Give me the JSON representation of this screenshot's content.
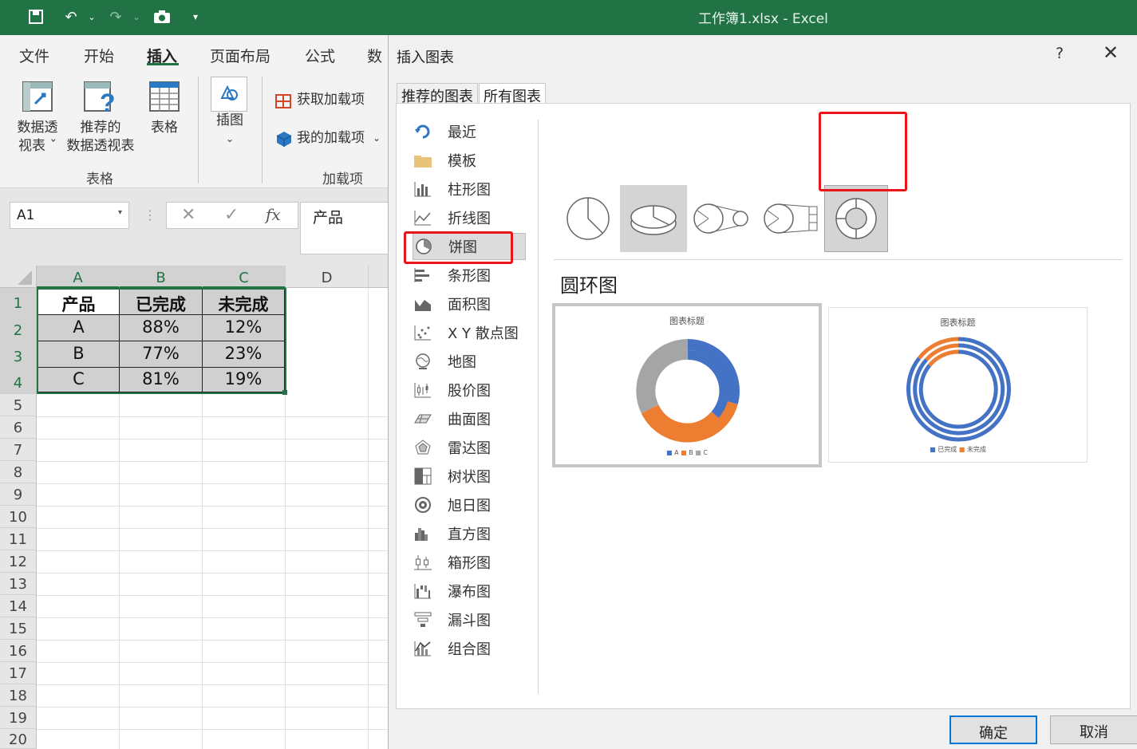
{
  "titlebar": {
    "title": "工作簿1.xlsx  -  Excel"
  },
  "ribbon": {
    "tabs": [
      "文件",
      "开始",
      "插入",
      "页面布局",
      "公式",
      "数"
    ],
    "active_tab": "插入",
    "buttons": {
      "pivot_table": [
        "数据透",
        "视表 ˇ"
      ],
      "recommended_pivot": [
        "推荐的",
        "数据透视表"
      ],
      "table": "表格",
      "illustrations": "插图",
      "get_addins": "获取加载项",
      "my_addins": "我的加载项"
    },
    "groups": {
      "tables": "表格",
      "addins": "加载项"
    }
  },
  "formula_bar": {
    "name_box": "A1",
    "value": "产品"
  },
  "sheet": {
    "columns": [
      "A",
      "B",
      "C",
      "D"
    ],
    "rows": [
      "1",
      "2",
      "3",
      "4",
      "5",
      "6",
      "7",
      "8",
      "9",
      "10",
      "11",
      "12",
      "13",
      "14",
      "15",
      "16",
      "17",
      "18",
      "19",
      "20"
    ],
    "table": [
      [
        "产品",
        "已完成",
        "未完成"
      ],
      [
        "A",
        "88%",
        "12%"
      ],
      [
        "B",
        "77%",
        "23%"
      ],
      [
        "C",
        "81%",
        "19%"
      ]
    ]
  },
  "dialog": {
    "title": "插入图表",
    "help": "?",
    "tabs": [
      "推荐的图表",
      "所有图表"
    ],
    "active_tab": "所有图表",
    "categories": [
      "最近",
      "模板",
      "柱形图",
      "折线图",
      "饼图",
      "条形图",
      "面积图",
      "X Y 散点图",
      "地图",
      "股价图",
      "曲面图",
      "雷达图",
      "树状图",
      "旭日图",
      "直方图",
      "箱形图",
      "瀑布图",
      "漏斗图",
      "组合图"
    ],
    "selected_category": "饼图",
    "subtypes": [
      "pie",
      "3d-pie",
      "pie-of-pie",
      "bar-of-pie",
      "doughnut"
    ],
    "selected_subtype": "doughnut",
    "preview_heading": "圆环图",
    "previews": [
      {
        "title": "图表标题",
        "legend": [
          "A",
          "B",
          "C"
        ]
      },
      {
        "title": "图表标题",
        "legend": [
          "已完成",
          "未完成"
        ]
      }
    ],
    "ok": "确定",
    "cancel": "取消"
  },
  "colors": {
    "excel_green": "#217346",
    "highlight_red": "#e8151b",
    "series_blue": "#4472c4",
    "series_orange": "#ed7d31",
    "series_gray": "#a5a5a5"
  }
}
